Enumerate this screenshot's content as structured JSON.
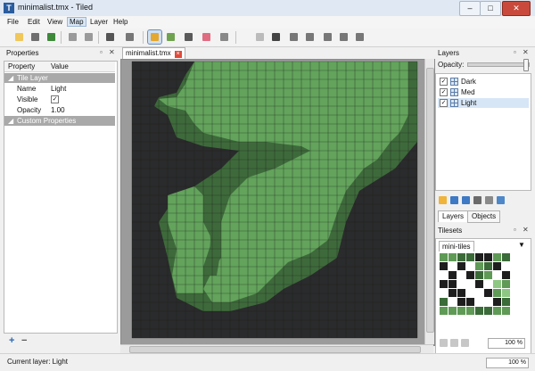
{
  "window": {
    "title": "minimalist.tmx - Tiled",
    "app_icon": "T"
  },
  "menu": [
    {
      "label": "File"
    },
    {
      "label": "Edit"
    },
    {
      "label": "View"
    },
    {
      "label": "Map"
    },
    {
      "label": "Layer"
    },
    {
      "label": "Help"
    }
  ],
  "toolbar": {
    "tools": [
      {
        "name": "new-map",
        "icon": "new-file-icon",
        "color": "#f0c75a"
      },
      {
        "name": "open",
        "icon": "open-folder-icon",
        "color": "#6f6f6f"
      },
      {
        "name": "save",
        "icon": "save-icon",
        "color": "#3e8a3a"
      },
      {
        "name": "undo",
        "icon": "undo-icon",
        "color": "#9a9a9a"
      },
      {
        "name": "redo",
        "icon": "redo-icon",
        "color": "#9a9a9a"
      },
      {
        "name": "random",
        "icon": "dice-icon",
        "color": "#555555"
      },
      {
        "name": "wang",
        "icon": "cubes-icon",
        "color": "#777777"
      },
      {
        "name": "stamp-brush",
        "icon": "stamp-brush-icon",
        "color": "#e4a72f",
        "selected": true
      },
      {
        "name": "terrain-brush",
        "icon": "terrain-brush-icon",
        "color": "#6fa24f"
      },
      {
        "name": "bucket-fill",
        "icon": "bucket-fill-icon",
        "color": "#5a5a5a"
      },
      {
        "name": "eraser",
        "icon": "eraser-icon",
        "color": "#e06c82"
      },
      {
        "name": "rect-select",
        "icon": "rect-select-icon",
        "color": "#888888"
      },
      {
        "name": "select-objects",
        "icon": "select-objects-icon",
        "color": "#bbbbbb"
      },
      {
        "name": "edit-polygons",
        "icon": "edit-polygons-icon",
        "color": "#444444"
      },
      {
        "name": "insert-rect",
        "icon": "insert-rect-icon",
        "color": "#777777"
      },
      {
        "name": "insert-ellipse",
        "icon": "insert-ellipse-icon",
        "color": "#777777"
      },
      {
        "name": "insert-polygon",
        "icon": "insert-polygon-icon",
        "color": "#777777"
      },
      {
        "name": "insert-polyline",
        "icon": "insert-polyline-icon",
        "color": "#777777"
      },
      {
        "name": "insert-tile",
        "icon": "insert-tile-icon",
        "color": "#777777"
      }
    ]
  },
  "properties_panel": {
    "title": "Properties",
    "columns": [
      "Property",
      "Value"
    ],
    "group_label": "Tile Layer",
    "rows": [
      {
        "name": "Name",
        "value": "Light"
      },
      {
        "name": "Visible",
        "value": "✓"
      },
      {
        "name": "Opacity",
        "value": "1.00"
      }
    ],
    "custom_label": "Custom Properties"
  },
  "document": {
    "tab_label": "minimalist.tmx",
    "tab_close": "×"
  },
  "map": {
    "grid_cols": 32,
    "grid_rows": 31,
    "colors": {
      "dark": "#2a2b2c",
      "med": "#3e6a3b",
      "light": "#63a35c",
      "grid": "#1b1b1b",
      "bg": "#9b9b9b"
    }
  },
  "layers_panel": {
    "title": "Layers",
    "opacity_label": "Opacity:",
    "layers": [
      {
        "name": "Dark",
        "visible": "✓"
      },
      {
        "name": "Med",
        "visible": "✓"
      },
      {
        "name": "Light",
        "visible": "✓",
        "selected": true
      }
    ],
    "tabs": [
      "Layers",
      "Objects"
    ]
  },
  "tilesets_panel": {
    "title": "Tilesets",
    "tab": "mini-tiles",
    "dropdown": "▼",
    "zoom": "100 %"
  },
  "status": {
    "current_layer": "Current layer: Light",
    "zoom": "100 %"
  }
}
